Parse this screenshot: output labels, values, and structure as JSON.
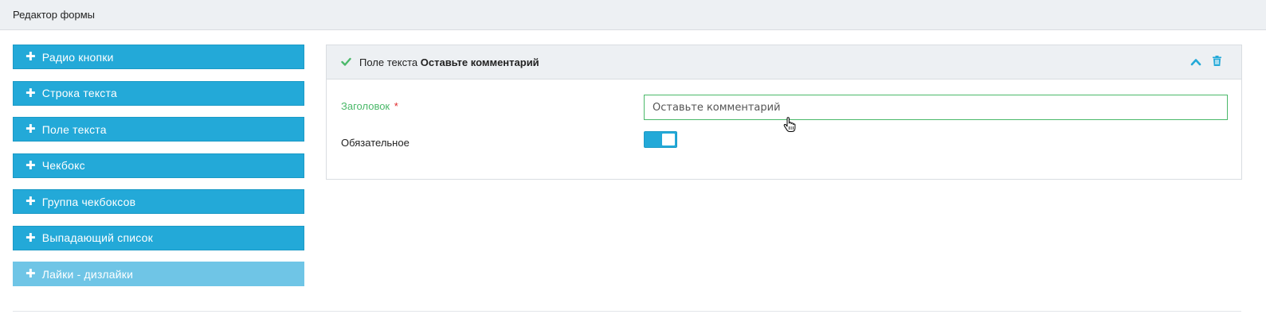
{
  "header": {
    "title": "Редактор формы"
  },
  "palette": {
    "items": [
      {
        "label": "Радио кнопки",
        "icon": "plus-icon"
      },
      {
        "label": "Строка текста",
        "icon": "plus-icon"
      },
      {
        "label": "Поле текста",
        "icon": "plus-icon"
      },
      {
        "label": "Чекбокс",
        "icon": "plus-icon"
      },
      {
        "label": "Группа чекбоксов",
        "icon": "plus-icon"
      },
      {
        "label": "Выпадающий список",
        "icon": "plus-icon"
      },
      {
        "label": "Лайки - дизлайки",
        "icon": "plus-icon",
        "disabled": true
      }
    ]
  },
  "editor": {
    "field_type": "Поле текста",
    "field_name": "Оставьте комментарий",
    "title_label": "Заголовок",
    "required_mark": "*",
    "title_value": "Оставьте комментарий",
    "required_label": "Обязательное",
    "required_on": true
  },
  "colors": {
    "accent": "#23a9d8",
    "accent_disabled": "#6fc5e6",
    "success": "#4bb96a",
    "required": "#e0282b",
    "header_bg": "#edf0f3"
  }
}
